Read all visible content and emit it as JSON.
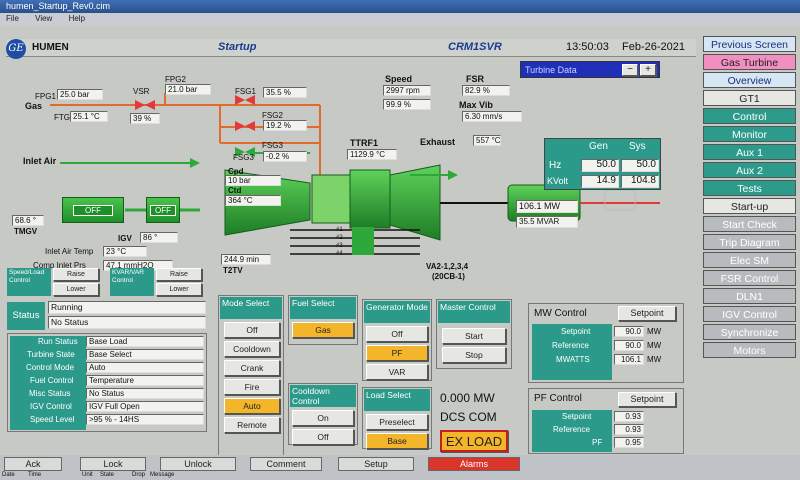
{
  "window": {
    "title": "humen_Startup_Rev0.cim"
  },
  "menu": [
    "File",
    "View",
    "Help"
  ],
  "header": {
    "brand": "HUMEN",
    "screen": "Startup",
    "unit": "CRM1SVR",
    "time": "13:50:03",
    "date": "Feb-26-2021"
  },
  "turbine_data": {
    "label": "Turbine Data",
    "minus": "−",
    "plus": "+"
  },
  "nav": [
    {
      "label": "Previous Screen",
      "style": "light"
    },
    {
      "label": "Gas Turbine",
      "style": "pink"
    },
    {
      "label": "Overview",
      "style": "light"
    },
    {
      "label": "GT1",
      "style": "white"
    },
    {
      "label": "Control",
      "style": "teal"
    },
    {
      "label": "Monitor",
      "style": "teal"
    },
    {
      "label": "Aux 1",
      "style": "teal"
    },
    {
      "label": "Aux 2",
      "style": "teal"
    },
    {
      "label": "Tests",
      "style": "teal"
    },
    {
      "label": "Start-up",
      "style": "white"
    },
    {
      "label": "Start Check",
      "style": "gray"
    },
    {
      "label": "Trip Diagram",
      "style": "gray"
    },
    {
      "label": "Elec SM",
      "style": "gray"
    },
    {
      "label": "FSR Control",
      "style": "gray"
    },
    {
      "label": "DLN1",
      "style": "gray"
    },
    {
      "label": "IGV Control",
      "style": "gray"
    },
    {
      "label": "Synchronize",
      "style": "gray"
    },
    {
      "label": "Motors",
      "style": "gray"
    }
  ],
  "process": {
    "fpg1_label": "FPG1",
    "fpg1_value": "25.0 bar",
    "gas_label": "Gas",
    "ftg_label": "FTG",
    "ftg_value": "25.1 °C",
    "vsr_label": "VSR",
    "vsr_value": "39 %",
    "fpg2_label": "FPG2",
    "fpg2_value": "21.0 bar",
    "fsg1_label": "FSG1",
    "fsg1_value": "35.5 %",
    "fsg2_label": "FSG2",
    "fsg2_value": "19.2 %",
    "fsg3_label": "FSG3",
    "fsg3_value": "-0.2 %",
    "speed_label": "Speed",
    "speed_rpm": "2997 rpm",
    "speed_pct": "99.9 %",
    "fsr_label": "FSR",
    "fsr_value": "82.9 %",
    "maxvib_label": "Max Vib",
    "maxvib_value": "6.30 mm/s",
    "ttrf1_label": "TTRF1",
    "ttrf1_value": "1129.9 °C",
    "exhaust_label": "Exhaust",
    "exhaust_value": "557 °C",
    "inlet_air": "Inlet Air",
    "cpd_label": "Cpd",
    "cpd_value": "10 bar",
    "ctd_label": "Ctd",
    "ctd_value": "364 °C",
    "igv_label": "IGV",
    "igv_value": "86 °",
    "tmgv_value": "68.6 °",
    "tmgv_label": "TMGV",
    "off1": "OFF",
    "off2": "OFF",
    "inlet_air_temp_label": "Inlet Air Temp",
    "inlet_air_temp_value": "23 °C",
    "comp_inlet_prs_label": "Comp Inlet Prs",
    "comp_inlet_prs_value": "47.1 mmH2O",
    "t2tv_value": "244.9 min",
    "t2tv_label": "T2TV",
    "va2_label": "VA2-1,2,3,4",
    "va2_sub": "(20CB-1)",
    "mw_value": "106.1 MW",
    "mvar_value": "35.5 MVAR",
    "bus": [
      {
        "label": "#1"
      },
      {
        "label": "#2"
      },
      {
        "label": "#3"
      },
      {
        "label": "#4"
      }
    ]
  },
  "gen_sys": {
    "col_gen": "Gen",
    "col_sys": "Sys",
    "rows": [
      {
        "label": "Hz",
        "gen": "50.0",
        "sys": "50.0"
      },
      {
        "label": "KVolt",
        "gen": "14.9",
        "sys": "104.8"
      }
    ]
  },
  "raise_lower": [
    {
      "title": "Speed/Load Control",
      "raise": "Raise",
      "lower": "Lower"
    },
    {
      "title": "KVAR/VAR Control",
      "raise": "Raise",
      "lower": "Lower"
    }
  ],
  "status": {
    "label": "Status",
    "line1": "Running",
    "line2": "No Status"
  },
  "run_status": [
    {
      "label": "Run Status",
      "value": "Base Load"
    },
    {
      "label": "Turbine State",
      "value": "Base Select"
    },
    {
      "label": "Control Mode",
      "value": "Auto"
    },
    {
      "label": "Fuel Control",
      "value": "Temperature"
    },
    {
      "label": "Misc Status",
      "value": "No Status"
    },
    {
      "label": "IGV Control",
      "value": "IGV Full Open"
    },
    {
      "label": "Speed Level",
      "value": ">95 % - 14HS"
    }
  ],
  "mode_select": {
    "title": "Mode Select",
    "buttons": [
      "Off",
      "Cooldown",
      "Crank",
      "Fire",
      "Auto",
      "Remote"
    ],
    "selected": "Auto"
  },
  "fuel_select": {
    "title": "Fuel Select",
    "value": "Gas"
  },
  "cooldown": {
    "title": "Cooldown Control",
    "on": "On",
    "off": "Off"
  },
  "generator_mode": {
    "title": "Generator Mode",
    "buttons": [
      "Off",
      "PF",
      "VAR"
    ],
    "selected": "PF"
  },
  "load_select": {
    "title": "Load Select",
    "preselect": "Preselect",
    "base": "Base"
  },
  "master_control": {
    "title": "Master Control",
    "start": "Start",
    "stop": "Stop"
  },
  "dcs": {
    "mw": "0.000 MW",
    "label": "DCS COM",
    "ex_load": "EX LOAD"
  },
  "mw_control": {
    "title": "MW Control",
    "setpoint_btn": "Setpoint",
    "rows": [
      {
        "label": "Setpoint",
        "value": "90.0",
        "unit": "MW"
      },
      {
        "label": "Reference",
        "value": "90.0",
        "unit": "MW"
      },
      {
        "label": "MWATTS",
        "value": "106.1",
        "unit": "MW"
      }
    ]
  },
  "pf_control": {
    "title": "PF Control",
    "setpoint_btn": "Setpoint",
    "rows": [
      {
        "label": "Setpoint",
        "value": "0.93"
      },
      {
        "label": "Reference",
        "value": "0.93"
      },
      {
        "label": "PF",
        "value": "0.95"
      }
    ]
  },
  "footer": {
    "buttons": [
      "Ack",
      "Lock",
      "Unlock",
      "Comment",
      "Setup",
      "Alarms"
    ],
    "alarm_cols": [
      "Date",
      "Time",
      "Unit",
      "State",
      "Drop",
      "Message"
    ]
  },
  "colors": {
    "teal": "#2c9a8a",
    "amber": "#f3b52a",
    "green": "#2ea83a",
    "alarm_red": "#d9352b"
  }
}
